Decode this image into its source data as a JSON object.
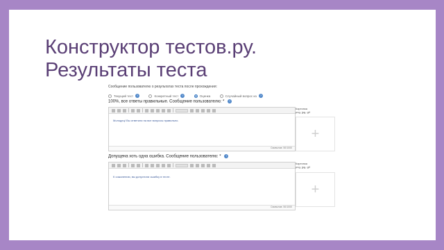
{
  "title": {
    "line1": "Конструктор тестов.ру.",
    "line2": "Результаты теста"
  },
  "question_text": "Сообщение пользователю о результатах теста после прохождения:",
  "radio_options": [
    {
      "label": "Текущий тест",
      "selected": false
    },
    {
      "label": "Конкретный тест",
      "selected": false
    },
    {
      "label": "Оценка",
      "selected": true
    },
    {
      "label": "Случайный вопрос из",
      "selected": false
    }
  ],
  "help_icon": "?",
  "sections": [
    {
      "label": "100%, все ответы правильные. Сообщение пользователю: *",
      "toolbar_select": "Размер",
      "content": "Молодец! Вы ответили на все вопросы правильно.",
      "status": "Символов: 50/1000",
      "side_label_1": "Картинка",
      "side_label_2": "png, jpg, gif"
    },
    {
      "label": "Допущена хоть одна ошибка. Сообщение пользователю: *",
      "toolbar_select": "Размер",
      "content": "К сожалению, вы допустили ошибку в тесте.",
      "status": "Символов: 50/1000",
      "side_label_1": "Картинка",
      "side_label_2": "png, jpg, gif"
    }
  ],
  "add_image_symbol": "+",
  "colors": {
    "frame": "#a786c6",
    "title": "#5a3f75",
    "radio_selected": "#2a6fbd",
    "help_icon": "#4f87c9"
  }
}
